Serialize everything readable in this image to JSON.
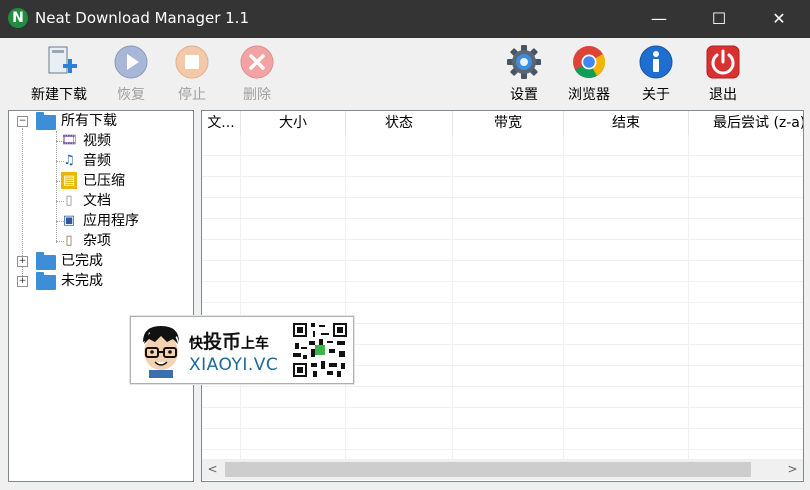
{
  "window": {
    "title": "Neat Download Manager 1.1",
    "app_icon_letter": "N",
    "controls": {
      "minimize": "—",
      "maximize": "☐",
      "close": "✕"
    }
  },
  "toolbar": {
    "left": [
      {
        "name": "new-download",
        "label": "新建下载",
        "icon": "new-download-icon",
        "enabled": true
      },
      {
        "name": "resume",
        "label": "恢复",
        "icon": "play-icon",
        "enabled": false
      },
      {
        "name": "stop",
        "label": "停止",
        "icon": "stop-icon",
        "enabled": false
      },
      {
        "name": "delete",
        "label": "删除",
        "icon": "delete-icon",
        "enabled": false
      }
    ],
    "right": [
      {
        "name": "settings",
        "label": "设置",
        "icon": "gear-icon",
        "enabled": true
      },
      {
        "name": "browser",
        "label": "浏览器",
        "icon": "chrome-icon",
        "enabled": true
      },
      {
        "name": "about",
        "label": "关于",
        "icon": "info-icon",
        "enabled": true
      },
      {
        "name": "exit",
        "label": "退出",
        "icon": "power-icon",
        "enabled": true
      }
    ]
  },
  "tree": {
    "root": {
      "label": "所有下载",
      "expander": "−"
    },
    "children": [
      {
        "label": "视频",
        "icon": "video-file-icon",
        "glyph": "🎞"
      },
      {
        "label": "音频",
        "icon": "music-note-icon",
        "glyph": "♫"
      },
      {
        "label": "已压缩",
        "icon": "archive-icon",
        "glyph": "▤"
      },
      {
        "label": "文档",
        "icon": "document-icon",
        "glyph": "▯"
      },
      {
        "label": "应用程序",
        "icon": "application-icon",
        "glyph": "▣"
      },
      {
        "label": "杂项",
        "icon": "misc-file-icon",
        "glyph": "▯"
      }
    ],
    "siblings": [
      {
        "label": "已完成",
        "expander": "+"
      },
      {
        "label": "未完成",
        "expander": "+"
      }
    ]
  },
  "list": {
    "columns": [
      "文...",
      "大小",
      "状态",
      "带宽",
      "结束",
      "最后尝试 (z-a)"
    ],
    "scroll_left": "<",
    "scroll_right": ">"
  },
  "watermark": {
    "text_small1": "快",
    "text_big": "投币",
    "text_small2": "上车",
    "site": "XIAOYI.VC"
  }
}
